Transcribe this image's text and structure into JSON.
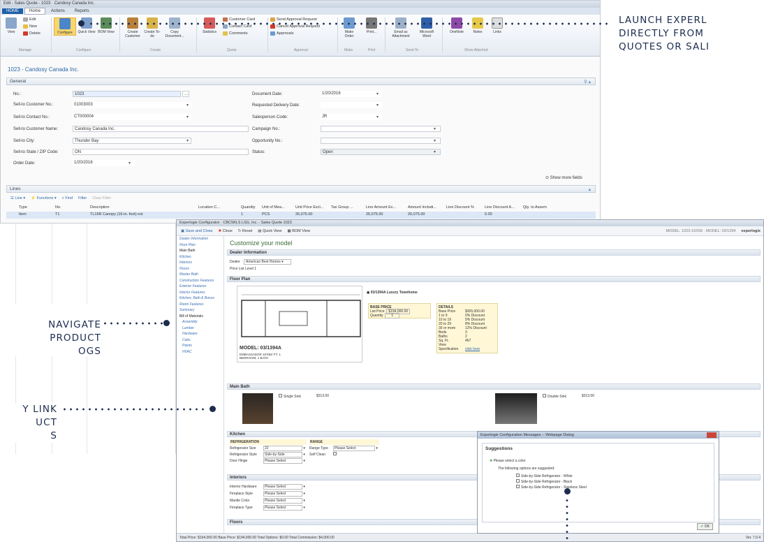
{
  "nav": {
    "title": "Edit - Sales Quote - 1023 · Candosy Canada Inc.",
    "tabs": [
      "HOME",
      "Home",
      "Actions",
      "Reports"
    ],
    "ribbon": {
      "view": "View",
      "edit": "Edit",
      "new": "New",
      "delete": "Delete",
      "configure": "Configure",
      "quick_view": "Quick View",
      "bom_view": "BOM View",
      "create_customer": "Create Customer",
      "create_todo": "Create To-do",
      "copy_document": "Copy Document...",
      "statistics": "Statistics",
      "customer_card": "Customer Card",
      "contact_card": "Contact Card",
      "comments": "Comments",
      "send_approval": "Send Approval Request",
      "cancel_approval": "Cancel Approval Request",
      "approvals": "Approvals",
      "make_order": "Make Order",
      "print": "Print...",
      "email_attachment": "Email as Attachment",
      "ms_word": "Microsoft Word",
      "onenote": "OneNote",
      "notes": "Notes",
      "links": "Links",
      "groups": [
        "Manage",
        "Configure",
        "Create",
        "Quote",
        "Approval",
        "Make",
        "Print",
        "Send To",
        "Show Attached"
      ]
    },
    "record_title": "1023 - Candosy Canada Inc.",
    "general": "General",
    "fields_left": [
      {
        "label": "No.:",
        "value": "1023"
      },
      {
        "label": "Sell-to Customer No.:",
        "value": "01003003"
      },
      {
        "label": "Sell-to Contact No.:",
        "value": "CT000004"
      },
      {
        "label": "Sell-to Customer Name:",
        "value": "Candosy Canada Inc."
      },
      {
        "label": "Sell-to City:",
        "value": "Thunder Bay"
      },
      {
        "label": "Sell-to State / ZIP Code:",
        "value": "ON"
      },
      {
        "label": "Order Date:",
        "value": "1/20/2016"
      }
    ],
    "fields_right": [
      {
        "label": "Document Date:",
        "value": "1/20/2016"
      },
      {
        "label": "Requested Delivery Date:",
        "value": ""
      },
      {
        "label": "Salesperson Code:",
        "value": "JR"
      },
      {
        "label": "Campaign No.:",
        "value": ""
      },
      {
        "label": "Opportunity No.:",
        "value": ""
      },
      {
        "label": "Status:",
        "value": "Open"
      }
    ],
    "show_more": "Show more fields",
    "lines": "Lines",
    "lines_toolbar": [
      "Line",
      "Functions",
      "Find",
      "Filter",
      "Clear Filter"
    ],
    "grid_headers": [
      "Type",
      "No.",
      "Description",
      "Location C...",
      "Quantity",
      "Unit of Mea...",
      "Unit Price Excl...",
      "Tax Group ...",
      "Line Amount Ex...",
      "Amount Includi...",
      "Line Discount %",
      "Line Discount A...",
      "Qty. to Assem"
    ],
    "grid_row": [
      "Item",
      "T1",
      "TL16R Canopy (16-in. foot) ext",
      "",
      "1",
      "PCS",
      "26,075.00",
      "",
      "26,075.00",
      "26,075.00",
      "",
      "0.00",
      ""
    ]
  },
  "cfg": {
    "title": "Experlogix Configurator · CBCWILS LSG, Inc. - Sales Quote 1023",
    "toolbar": [
      "Save and Close",
      "Close",
      "Reset",
      "Quick View",
      "BOM View"
    ],
    "right_status": "MODEL: 1023-16X56 · MODEL: 03/1394",
    "brand": "experlogix",
    "sidebar": [
      "Dealer Information",
      "Floor Plan",
      "Main Bath",
      "Kitchen",
      "Interiors",
      "Floors",
      "Master Bath",
      "Construction Features",
      "Exterior Features",
      "Interior Features",
      "Kitchen, Bath & Bonus Room Features",
      "Summary",
      "Bill of Materials",
      "Assembly",
      "Lumber",
      "Hardware",
      "Cabs",
      "Paints",
      "HVAC"
    ],
    "heading": "Customize your model",
    "dealer_section": "Dealer Information",
    "dealer_label": "Dealer",
    "dealer_value": "American Best Homes",
    "price_list": "Price List Level 1",
    "floor_section": "Floor Plan",
    "model_radio": "03/1394A Luxury Townhome",
    "base_price": "BASE PRICE",
    "list_price_label": "List Price",
    "list_price": "$194,000.00",
    "quantity_label": "Quantity",
    "quantity": "1",
    "details": "DETAILS",
    "details_rows": [
      [
        "Base Price",
        "$305,000.00"
      ],
      [
        "1 to 9",
        "0% Discount"
      ],
      [
        "10 to 19",
        "5% Discount"
      ],
      [
        "20 to 29",
        "8% Discount"
      ],
      [
        "30 or more",
        "12% Discount"
      ],
      [
        "Beds",
        "3"
      ],
      [
        "Baths",
        "2"
      ],
      [
        "Sq. Ft.",
        "467"
      ],
      [
        "View Specification",
        "click here"
      ]
    ],
    "model_caption": "MODEL: 03/1394A",
    "model_sub": "EMBASSADOR 16'X56' FT. 1 BEDROOM, 1 BATH",
    "bath_section": "Main Bath",
    "single_sink": "Single Sink",
    "single_price": "$313.00",
    "double_sink": "Double Sink",
    "double_price": "$313.00",
    "kitchen_section": "Kitchen",
    "refrigeration": "REFRIGERATION",
    "range": "RANGE",
    "kitchen_rows": [
      [
        "Refrigerator Size",
        "22"
      ],
      [
        "Refrigerator Style",
        "Side-by-Side"
      ],
      [
        "Door Hinge",
        "Please Select"
      ]
    ],
    "range_rows": [
      [
        "Range Type",
        "Please Select"
      ],
      [
        "Self Clean",
        ""
      ]
    ],
    "interiors_section": "Interiors",
    "interior_rows": [
      [
        "Interior Hardware",
        "Please Select"
      ],
      [
        "Fireplace Style",
        "Please Select"
      ],
      [
        "Mantle Color",
        "Please Select"
      ],
      [
        "Fireplace Type",
        "Please Select"
      ]
    ],
    "floors_section": "Floors",
    "status": "Total Price: $194,000.00    Base Price: $194,000.00    Total Options: $0.00    Total Commission: $4,000.00",
    "version": "Ver. 7.0.4"
  },
  "dialog": {
    "title": "Experlogix Configuration Messages -- Webpage Dialog",
    "heading": "Suggestions",
    "item": "Please select a color",
    "sub": "The following options are suggested:",
    "options": [
      "Side-by-Side Refrigerator - White",
      "Side-by-Side Refrigerator - Black",
      "Side-by-Side Refrigerator - Stainless Steel"
    ],
    "ok": "OK"
  },
  "callouts": {
    "top": "LAUNCH EXPERL\nDIRECTLY FROM\nQUOTES OR SALI",
    "mid": "NAVIGATE\nPRODUCT\nOGS",
    "bottom": "Y LINK\nUCT\nS"
  }
}
